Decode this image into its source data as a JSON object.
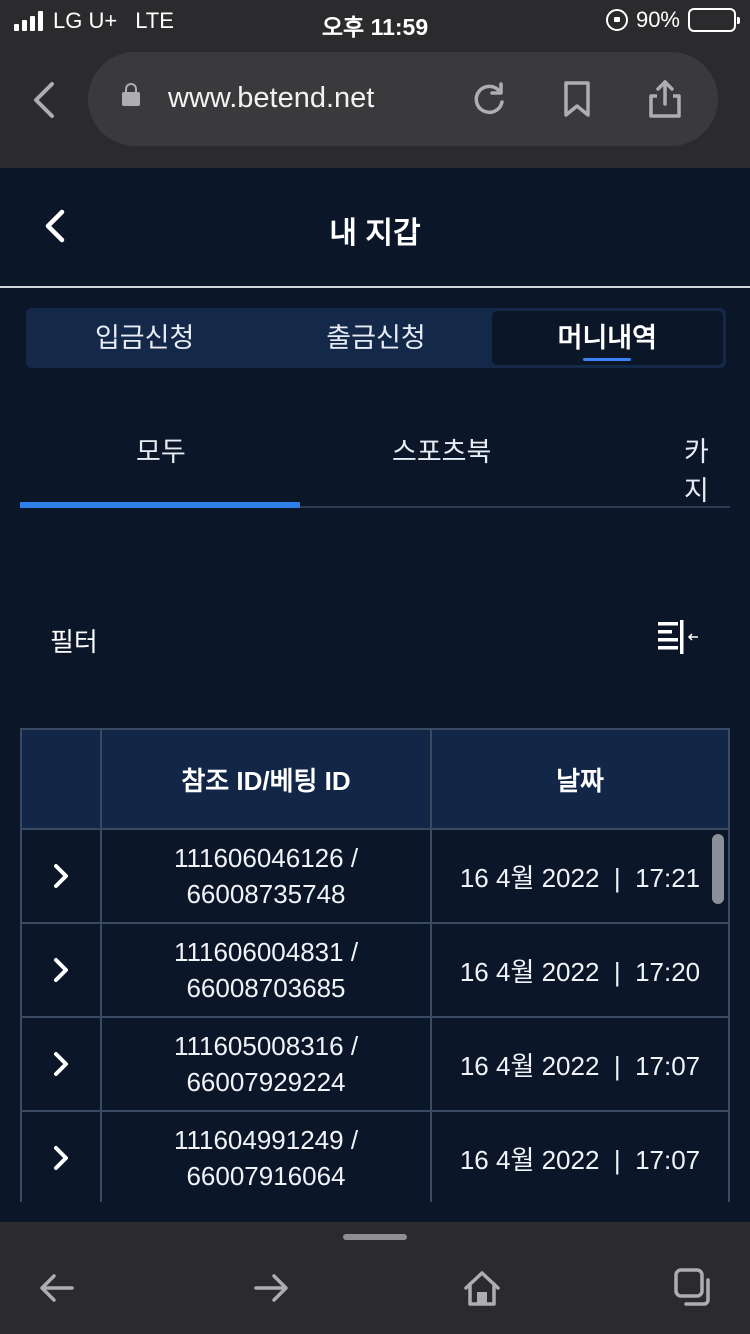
{
  "status_bar": {
    "carrier": "LG U+",
    "network": "LTE",
    "time": "오후 11:59",
    "battery": "90%",
    "battery_level": 0.9
  },
  "browser": {
    "url": "www.betend.net"
  },
  "header": {
    "title": "내 지갑"
  },
  "segments": [
    {
      "label": "입금신청",
      "active": false
    },
    {
      "label": "출금신청",
      "active": false
    },
    {
      "label": "머니내역",
      "active": true
    }
  ],
  "category_tabs": [
    {
      "label": "모두",
      "active": true
    },
    {
      "label": "스포츠북",
      "active": false
    },
    {
      "label": "카지",
      "active": false
    }
  ],
  "filter": {
    "label": "필터"
  },
  "table": {
    "headers": [
      "",
      "참조 ID/베팅 ID",
      "날짜"
    ],
    "rows": [
      {
        "ref": "111606046126 /",
        "bet": "66008735748",
        "date": "16 4월 2022  |  17:21"
      },
      {
        "ref": "111606004831 /",
        "bet": "66008703685",
        "date": "16 4월 2022  |  17:20"
      },
      {
        "ref": "111605008316 /",
        "bet": "66007929224",
        "date": "16 4월 2022  |  17:07"
      },
      {
        "ref": "111604991249 /",
        "bet": "66007916064",
        "date": "16 4월 2022  |  17:07"
      }
    ]
  },
  "colors": {
    "background": "#0b1629",
    "accent": "#2f7fe8",
    "header_row": "#122648",
    "segment_bg": "#14284a"
  }
}
